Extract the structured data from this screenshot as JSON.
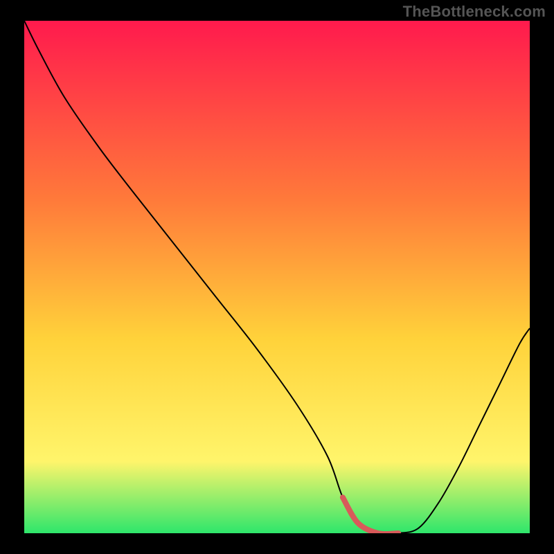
{
  "watermark": "TheBottleneck.com",
  "colors": {
    "page_bg": "#000000",
    "watermark": "#555555",
    "curve": "#000000",
    "highlight": "#d85a5a",
    "gradient_top": "#ff1a4d",
    "gradient_mid1": "#ff7a3a",
    "gradient_mid2": "#ffd23a",
    "gradient_mid3": "#fff56b",
    "gradient_bottom": "#2ee66b"
  },
  "chart_data": {
    "type": "line",
    "title": "",
    "xlabel": "",
    "ylabel": "",
    "xlim": [
      0,
      100
    ],
    "ylim": [
      0,
      100
    ],
    "x": [
      0,
      3,
      8,
      15,
      22,
      30,
      38,
      46,
      54,
      60,
      63,
      66,
      70,
      74,
      78,
      82,
      86,
      90,
      94,
      98,
      100
    ],
    "values": [
      100,
      94,
      85,
      75,
      66,
      56,
      46,
      36,
      25,
      15,
      7,
      2,
      0,
      0,
      1,
      6,
      13,
      21,
      29,
      37,
      40
    ],
    "highlight_range_x": [
      62,
      76
    ],
    "gradient_stops": [
      {
        "offset": 0.0,
        "key": "gradient_top"
      },
      {
        "offset": 0.35,
        "key": "gradient_mid1"
      },
      {
        "offset": 0.62,
        "key": "gradient_mid2"
      },
      {
        "offset": 0.86,
        "key": "gradient_mid3"
      },
      {
        "offset": 1.0,
        "key": "gradient_bottom"
      }
    ]
  }
}
